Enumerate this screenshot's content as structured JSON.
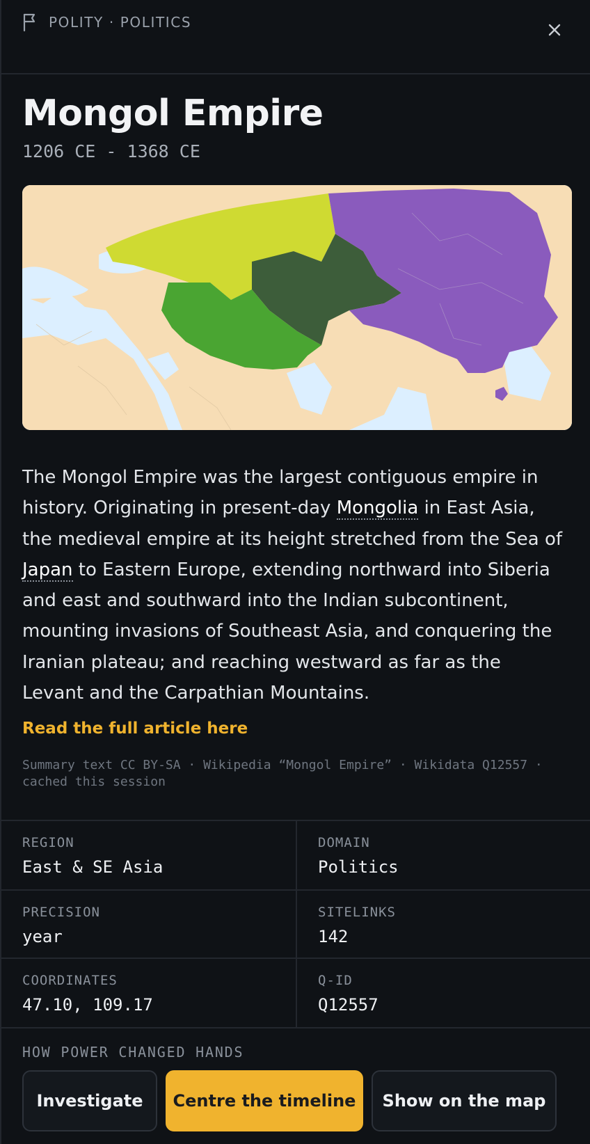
{
  "header": {
    "kind_label": "POLITY · POLITICS",
    "kind_icon": "flag-icon",
    "close_icon": "close-icon"
  },
  "entity": {
    "title": "Mongol Empire",
    "dates": "1206 CE - 1368 CE"
  },
  "map": {
    "icon": "territory-map",
    "colors": {
      "sea": "#dcefff",
      "land": "#f7ddb5",
      "golden_horde": "#cfda32",
      "chagatai": "#3d5d3a",
      "ilkhanate": "#4aa532",
      "yuan": "#8a5bbd"
    }
  },
  "summary": {
    "part1": "The Mongol Empire was the largest contiguous empire in history. Originating in present-day ",
    "link1": "Mongolia",
    "part2": " in East Asia, the medieval empire at its height stretched from the Sea of ",
    "link2": "Japan",
    "part3": " to Eastern Europe, extending northward into Siberia and east and southward into the Indian subcontinent, mounting invasions of Southeast Asia, and conquering the Iranian plateau; and reaching westward as far as the Levant and the Carpathian Mountains.",
    "read_more": "Read the full article here",
    "attribution": "Summary text CC BY-SA · Wikipedia “Mongol Empire” · Wikidata Q12557 · cached this session"
  },
  "facts": {
    "region": {
      "label": "REGION",
      "value": "East & SE Asia"
    },
    "domain": {
      "label": "DOMAIN",
      "value": "Politics"
    },
    "precision": {
      "label": "PRECISION",
      "value": "year"
    },
    "sitelinks": {
      "label": "SITELINKS",
      "value": "142"
    },
    "coordinates": {
      "label": "COORDINATES",
      "value": "47.10, 109.17"
    },
    "qid": {
      "label": "Q-ID",
      "value": "Q12557"
    }
  },
  "section_heading": "HOW POWER CHANGED HANDS",
  "actions": {
    "investigate": "Investigate",
    "centre": "Centre the timeline",
    "show_map": "Show on the map"
  },
  "colors": {
    "background": "#0f1216",
    "accent": "#f0b32e",
    "divider": "#23272e"
  }
}
